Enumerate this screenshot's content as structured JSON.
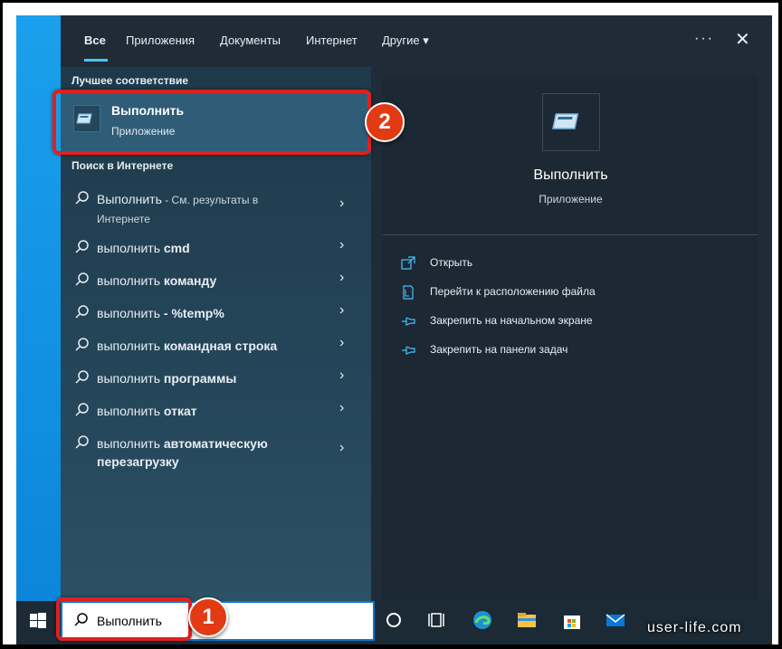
{
  "tabs": [
    {
      "label": "Все",
      "active": true
    },
    {
      "label": "Приложения"
    },
    {
      "label": "Документы"
    },
    {
      "label": "Интернет"
    },
    {
      "label": "Другие"
    }
  ],
  "best_match": {
    "section_title": "Лучшее соответствие",
    "title": "Выполнить",
    "subtitle": "Приложение"
  },
  "web_search": {
    "section_title": "Поиск в Интернете",
    "items": [
      {
        "plain": "Выполнить",
        "bold": "",
        "suffix": " - См. результаты в",
        "line2": "Интернете"
      },
      {
        "plain": "выполнить ",
        "bold": "cmd"
      },
      {
        "plain": "выполнить ",
        "bold": "команду"
      },
      {
        "plain": "выполнить ",
        "bold": "- %temp%"
      },
      {
        "plain": "выполнить ",
        "bold": "командная строка"
      },
      {
        "plain": "выполнить ",
        "bold": "программы"
      },
      {
        "plain": "выполнить ",
        "bold": "откат"
      },
      {
        "plain": "выполнить ",
        "bold": "автоматическую",
        "line2": "перезагрузку"
      }
    ]
  },
  "preview": {
    "title": "Выполнить",
    "subtitle": "Приложение",
    "actions": [
      {
        "label": "Открыть",
        "icon": "open-icon"
      },
      {
        "label": "Перейти к расположению файла",
        "icon": "file-location-icon"
      },
      {
        "label": "Закрепить на начальном экране",
        "icon": "pin-icon"
      },
      {
        "label": "Закрепить на панели задач",
        "icon": "pin-icon"
      }
    ]
  },
  "taskbar": {
    "search_value": "Выполнить",
    "icons": [
      "cortana-icon",
      "task-view-icon",
      "edge-icon",
      "file-explorer-icon",
      "store-icon",
      "mail-icon"
    ]
  },
  "annotations": {
    "badge1": "1",
    "badge2": "2",
    "accent": "#e0201f"
  },
  "watermark": "user-life.com",
  "colors": {
    "desktop": "#0a84d8",
    "menu": "#1f2c38",
    "accent": "#4cc2ff"
  }
}
